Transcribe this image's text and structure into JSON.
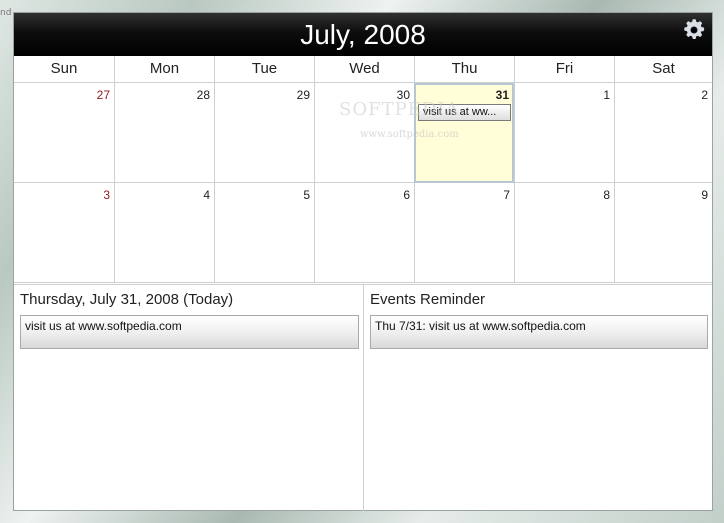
{
  "corner_text": "nd",
  "header": {
    "title": "July, 2008",
    "settings_icon": "gear-icon"
  },
  "weekdays": [
    "Sun",
    "Mon",
    "Tue",
    "Wed",
    "Thu",
    "Fri",
    "Sat"
  ],
  "weeks": [
    [
      "27",
      "28",
      "29",
      "30",
      "31",
      "1",
      "2"
    ],
    [
      "3",
      "4",
      "5",
      "6",
      "7",
      "8",
      "9"
    ]
  ],
  "today_cell": {
    "day": "31",
    "event_chip": "visit us at ww..."
  },
  "day_panel": {
    "title": "Thursday, July 31, 2008 (Today)",
    "event": "visit us at www.softpedia.com"
  },
  "reminder_panel": {
    "title": "Events Reminder",
    "event": "Thu 7/31: visit us at www.softpedia.com"
  },
  "watermark": {
    "text": "SOFTPEDIA",
    "sub": "www.softpedia.com"
  },
  "colors": {
    "header_bg": "#000000",
    "today_bg": "#fffed9",
    "sunday_num": "#8b1b1b"
  }
}
